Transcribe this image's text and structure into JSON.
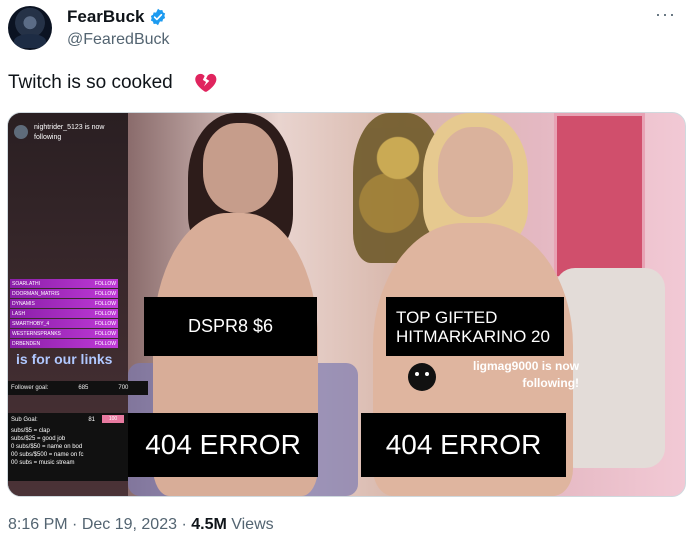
{
  "header": {
    "name": "FearBuck",
    "handle": "@FearedBuck",
    "more_label": "···"
  },
  "tweet": {
    "text": "Twitch is so cooked"
  },
  "media": {
    "follow_notice": "nightrider_5123 is now following",
    "feed_rows": [
      {
        "name": "SOARLATHI",
        "action": "FOLLOW"
      },
      {
        "name": "DOORMAN_MATRIS",
        "action": "FOLLOW"
      },
      {
        "name": "DYNAMIS",
        "action": "FOLLOW"
      },
      {
        "name": "LASH",
        "action": "FOLLOW"
      },
      {
        "name": "SMARTHOBY_4",
        "action": "FOLLOW"
      },
      {
        "name": "WESTERNSPRANKS",
        "action": "FOLLOW"
      },
      {
        "name": "DRBENDEN",
        "action": "FOLLOW"
      }
    ],
    "links_text": "is for our links",
    "follower_goal_label": "Follower goal:",
    "follower_goal_current": "685",
    "follower_goal_target": "700",
    "sub_goal_label": "Sub Goal:",
    "sub_goal_current": "81",
    "sub_goal_target": "100",
    "sub_goal_lines": [
      "subs/$5 = clap",
      "subs/$25 = good job",
      "0 subs/$50 = name on bod",
      "00 subs/$500 = name on fc",
      "00 subs = music stream"
    ],
    "dspr_label": "DSPR8 $6",
    "top_gifted_line1": "TOP GIFTED",
    "top_gifted_line2": "HITMARKARINO 20",
    "follow_msg_line1": "ligmag9000 is now",
    "follow_msg_line2": "following!",
    "error_left": "404 ERROR",
    "error_right": "404 ERROR"
  },
  "footer": {
    "time": "8:16 PM",
    "sep1": " · ",
    "date": "Dec 19, 2023",
    "sep2": " · ",
    "views_count": "4.5M",
    "views_label": " Views"
  },
  "colors": {
    "verified": "#1d9bf0",
    "heart": "#e0245e",
    "secondary_text": "#536471"
  }
}
